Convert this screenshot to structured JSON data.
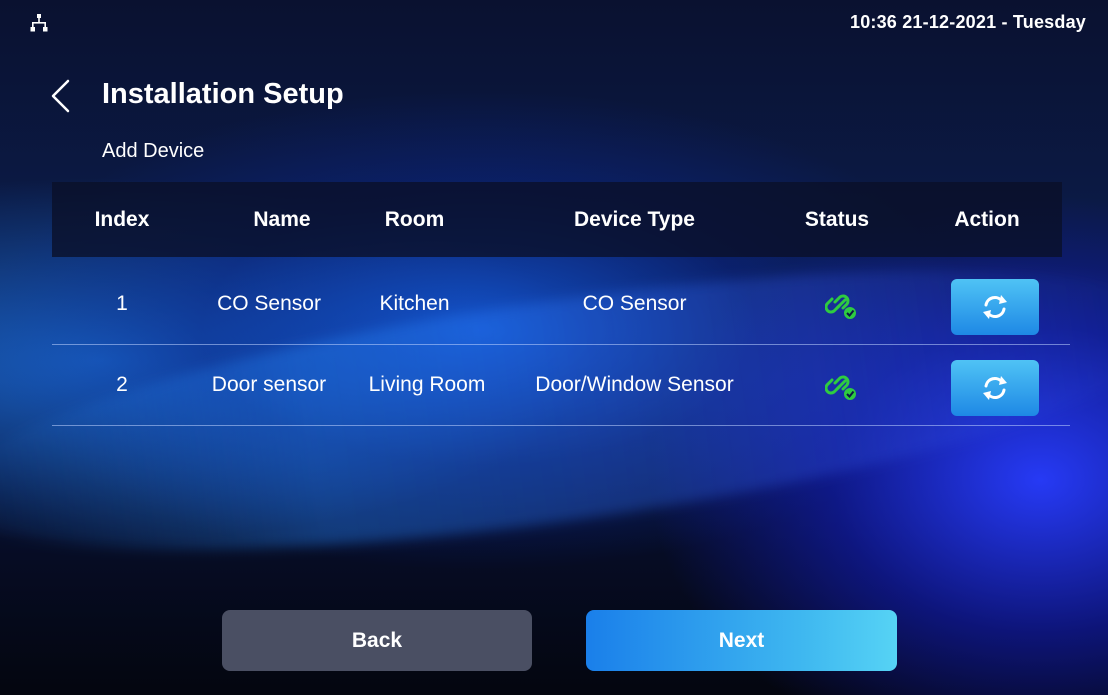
{
  "status_bar": {
    "network_icon": "network-icon",
    "clock": "10:36  21-12-2021 - Tuesday"
  },
  "header": {
    "back_icon": "chevron-left-icon",
    "title": "Installation Setup",
    "subtitle": "Add Device"
  },
  "table": {
    "columns": [
      "Index",
      "Name",
      "Room",
      "Device Type",
      "Status",
      "Action"
    ],
    "rows": [
      {
        "index": "1",
        "name": "CO Sensor",
        "room": "Kitchen",
        "device_type": "CO Sensor",
        "status_icon": "link-connected-icon",
        "action_icon": "sync-icon"
      },
      {
        "index": "2",
        "name": "Door sensor",
        "room": "Living Room",
        "device_type": "Door/Window Sensor",
        "status_icon": "link-connected-icon",
        "action_icon": "sync-icon"
      }
    ]
  },
  "footer": {
    "back_label": "Back",
    "next_label": "Next"
  },
  "colors": {
    "status_green": "#2ecc40",
    "action_blue": "#2f9be8",
    "next_blue": "#1a7fea",
    "back_gray": "#4a4f63"
  }
}
